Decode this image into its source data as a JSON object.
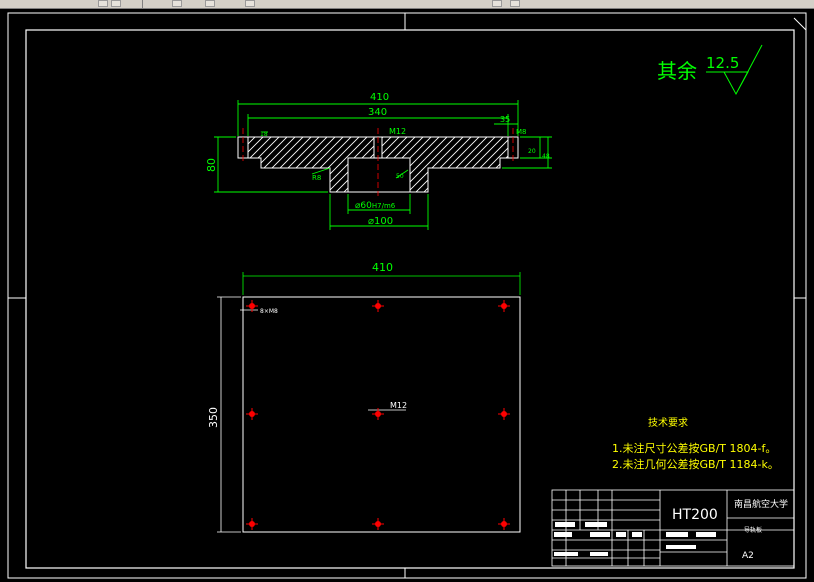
{
  "toolbar": {
    "icons": [
      "layer-icon",
      "properties-icon",
      "color-icon",
      "linetype-icon",
      "lineweight-icon",
      "plot-icon"
    ]
  },
  "roughness": {
    "label": "其余",
    "value": "12.5"
  },
  "section_view": {
    "overall_width": "410",
    "hole_span": "340",
    "thread_center": "M12",
    "thread_side": "M8",
    "dim_35": "35",
    "height": "80",
    "bore_fit_prefix": "⌀60",
    "bore_fit_suffix": "H7/m6",
    "boss_dia": "⌀100",
    "chamfer_label": "R8",
    "small_dims": [
      "18",
      "20",
      "48",
      "50"
    ]
  },
  "plan_view": {
    "width": "410",
    "height": "350",
    "hole_callout": "8×M8",
    "center_thread": "M12"
  },
  "tech_req": {
    "title": "技术要求",
    "lines": [
      "1.未注尺寸公差按GB/T 1804-f。",
      "2.未注几何公差按GB/T 1184-k。"
    ]
  },
  "title_block": {
    "material": "HT200",
    "school": "南昌航空大学",
    "part_name": "导轨板",
    "sheet_size": "A2"
  },
  "colors": {
    "outline": "#ffffff",
    "dimension": "#00ff00",
    "hatch": "#ffffff",
    "hole_mark": "#ff0000",
    "tech": "#ffff00"
  }
}
